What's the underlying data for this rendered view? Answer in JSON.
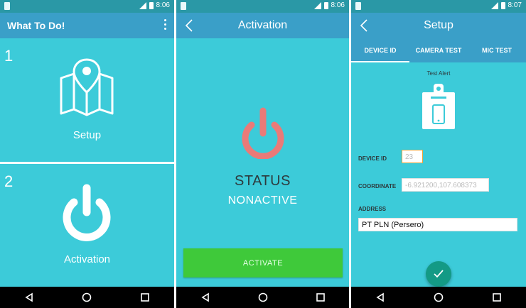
{
  "screens": {
    "home": {
      "status_time": "8:06",
      "app_title": "What To Do!",
      "tiles": [
        {
          "number": "1",
          "label": "Setup"
        },
        {
          "number": "2",
          "label": "Activation"
        }
      ]
    },
    "activation": {
      "status_time": "8:06",
      "title": "Activation",
      "status_label": "STATUS",
      "status_value": "NONACTIVE",
      "activate_button": "ACTIVATE"
    },
    "setup": {
      "status_time": "8:07",
      "title": "Setup",
      "tabs": [
        "DEVICE ID",
        "CAMERA TEST",
        "MIC TEST"
      ],
      "test_alert": "Test Alert",
      "device_id_label": "DEVICE ID",
      "device_id_value": "23",
      "coordinate_label": "COORDINATE",
      "coordinate_value": "-6.921200,107.608373",
      "address_label": "ADDRESS",
      "address_value": "PT PLN (Persero)"
    }
  },
  "colors": {
    "background": "#3ccbd9",
    "appbar": "#3a9fc8",
    "statusbar": "#2a98a6",
    "power_red": "#ea7a78",
    "activate_green": "#3fc93a",
    "fab": "#139a85"
  },
  "icons": [
    "map-pin-icon",
    "power-icon",
    "badge-phone-icon",
    "back-icon",
    "check-icon",
    "nav-back-icon",
    "nav-home-icon",
    "nav-recents-icon"
  ]
}
